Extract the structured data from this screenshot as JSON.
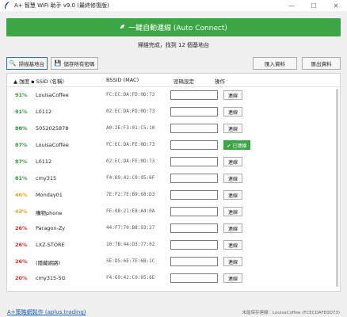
{
  "window": {
    "title": "A+ 智慧 WiFi 助手 v9.0 (最終修復版)",
    "minimize_glyph": "—",
    "maximize_glyph": "☐",
    "close_glyph": "✕"
  },
  "connect": {
    "label": "一鍵自動連線 (Auto Connect)",
    "icon": "leaf-icon",
    "color": "#3ca645"
  },
  "scan_status": "掃描完成，找到 12 個基地台",
  "toolbar": {
    "scan_label": "掃描基地台",
    "save_label": "儲存所有密碼",
    "import_label": "匯入資料",
    "export_label": "匯出資料"
  },
  "table": {
    "headers": {
      "signal_ssid": "▲ 強度 ▪ SSID (名稱)",
      "bssid": "BSSID (MAC)",
      "password": "密碼設定",
      "action": "操作"
    },
    "rows": [
      {
        "signal": "91%",
        "level": "high",
        "ssid": "LouisaCoffee",
        "bssid": "FC:EC:DA:FD:0D:73",
        "action": "連線"
      },
      {
        "signal": "91%",
        "level": "high",
        "ssid": "L0112",
        "bssid": "02:EC:DA:FD:0D:73",
        "action": "連線"
      },
      {
        "signal": "88%",
        "level": "high",
        "ssid": "5052025878",
        "bssid": "A0:2E:F3:01:C5:10",
        "action": "連線"
      },
      {
        "signal": "87%",
        "level": "high",
        "ssid": "LouisaCoffee",
        "bssid": "FC:EC:DA:FE:0D:73",
        "action": "✔ 已連線",
        "connected": true
      },
      {
        "signal": "87%",
        "level": "high",
        "ssid": "L0112",
        "bssid": "02:EC:DA:FE:0D:73",
        "action": "連線"
      },
      {
        "signal": "81%",
        "level": "high",
        "ssid": "cmy315",
        "bssid": "F4:69:42:C0:95:6F",
        "action": "連線"
      },
      {
        "signal": "46%",
        "level": "mid",
        "ssid": "Monday01",
        "bssid": "7E:F2:7E:B9:68:D3",
        "action": "連線"
      },
      {
        "signal": "43%",
        "level": "mid",
        "ssid": "購物phone",
        "bssid": "FE:08:21:E8:A4:0A",
        "action": "連線"
      },
      {
        "signal": "26%",
        "level": "low",
        "ssid": "Paragon-Zy",
        "bssid": "44:F7:70:B8:93:27",
        "action": "連線"
      },
      {
        "signal": "26%",
        "level": "low",
        "ssid": "LXZ-STORE",
        "bssid": "10:7B:44:D3:77:02",
        "action": "連線"
      },
      {
        "signal": "26%",
        "level": "low",
        "ssid": "(隱藏網路)",
        "bssid": "5E:D5:6E:7E:6B:1C",
        "action": "連線"
      },
      {
        "signal": "20%",
        "level": "low",
        "ssid": "cmy315-5G",
        "bssid": "F4:69:42:C0:95:6E",
        "action": "連線"
      }
    ]
  },
  "footer": {
    "link": "A+策略網製作 (aplus.trading)",
    "status": "未能保存連線：LouisaCoffee (FCECDAFE0D73)"
  }
}
